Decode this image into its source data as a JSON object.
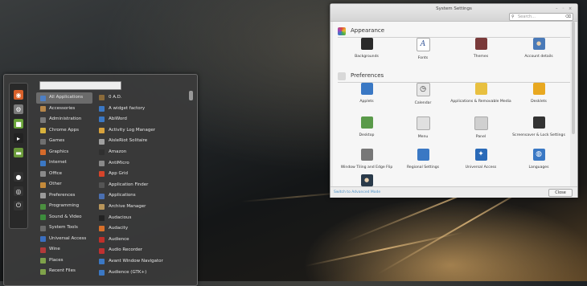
{
  "menu": {
    "categories": [
      {
        "label": "All Applications",
        "color": "#4d7fc4"
      },
      {
        "label": "Accessories",
        "color": "#b6864a"
      },
      {
        "label": "Administration",
        "color": "#7a7a7a"
      },
      {
        "label": "Chrome Apps",
        "color": "#d8b23c"
      },
      {
        "label": "Games",
        "color": "#6f6f6f"
      },
      {
        "label": "Graphics",
        "color": "#d66a2a"
      },
      {
        "label": "Internet",
        "color": "#3b78c4"
      },
      {
        "label": "Office",
        "color": "#8a8a8a"
      },
      {
        "label": "Other",
        "color": "#c48a3a"
      },
      {
        "label": "Preferences",
        "color": "#9a9a9a"
      },
      {
        "label": "Programming",
        "color": "#4b8f3f"
      },
      {
        "label": "Sound & Video",
        "color": "#3c8c3c"
      },
      {
        "label": "System Tools",
        "color": "#6b6b6b"
      },
      {
        "label": "Universal Access",
        "color": "#3b6fc0"
      },
      {
        "label": "Wine",
        "color": "#b33a3a"
      },
      {
        "label": "Places",
        "color": "#7fa24a"
      },
      {
        "label": "Recent Files",
        "color": "#7fa24a"
      }
    ],
    "apps": [
      {
        "label": "0 A.D.",
        "color": "#8a6a3a"
      },
      {
        "label": "A widget factory",
        "color": "#3b78c4"
      },
      {
        "label": "AbiWord",
        "color": "#3b78c4"
      },
      {
        "label": "Activity Log Manager",
        "color": "#d8a23c"
      },
      {
        "label": "AisleRiot Solitaire",
        "color": "#a0a0a0"
      },
      {
        "label": "Amazon",
        "color": "#303030"
      },
      {
        "label": "AntiMicro",
        "color": "#8a8a8a"
      },
      {
        "label": "App Grid",
        "color": "#d6442a"
      },
      {
        "label": "Application Finder",
        "color": "#555555"
      },
      {
        "label": "Applications",
        "color": "#4a6fb0"
      },
      {
        "label": "Archive Manager",
        "color": "#b8955a"
      },
      {
        "label": "Audacious",
        "color": "#222222"
      },
      {
        "label": "Audacity",
        "color": "#d8702a"
      },
      {
        "label": "Audience",
        "color": "#c0302a"
      },
      {
        "label": "Audio Recorder",
        "color": "#c03030"
      },
      {
        "label": "Avant Window Navigator",
        "color": "#3b78c4"
      },
      {
        "label": "Audience (GTK+)",
        "color": "#3b78c4"
      }
    ],
    "favorites": [
      {
        "icon": "firefox-icon",
        "glyph": "◉",
        "color": "#d8602a"
      },
      {
        "icon": "settings-icon",
        "glyph": "⚙",
        "color": "#7a7a7a"
      },
      {
        "icon": "software-icon",
        "glyph": "■",
        "color": "#6aa43a"
      },
      {
        "icon": "terminal-icon",
        "glyph": "▸",
        "color": "#222222"
      },
      {
        "icon": "files-icon",
        "glyph": "▬",
        "color": "#6a9a3a"
      },
      {
        "icon": "lock-icon",
        "glyph": "●",
        "color": "#333333"
      },
      {
        "icon": "logout-icon",
        "glyph": "◎",
        "color": "#333333"
      },
      {
        "icon": "shutdown-icon",
        "glyph": "⏻",
        "color": "#333333"
      }
    ]
  },
  "window": {
    "title": "System Settings",
    "search_placeholder": "Search...",
    "advanced_link": "Switch to Advanced Mode",
    "close_label": "Close",
    "sections": [
      {
        "title": "Appearance",
        "icon": "appearance-icon",
        "color": "#e05a2a",
        "items": [
          {
            "label": "Backgrounds",
            "icon": "backgrounds-icon",
            "color": "#2a2a2a"
          },
          {
            "label": "Fonts",
            "icon": "fonts-icon",
            "color": "#ffffff"
          },
          {
            "label": "Themes",
            "icon": "themes-icon",
            "color": "#7a3a3a"
          },
          {
            "label": "Account details",
            "icon": "account-icon",
            "color": "#4a7ab8"
          }
        ]
      },
      {
        "title": "Preferences",
        "icon": "preferences-icon",
        "color": "#d8d8d8",
        "items": [
          {
            "label": "Applets",
            "icon": "applets-icon",
            "color": "#3a78c4"
          },
          {
            "label": "Calendar",
            "icon": "calendar-icon",
            "color": "#e8e8e8"
          },
          {
            "label": "Applications & Removable Media",
            "icon": "media-icon",
            "color": "#e8c040"
          },
          {
            "label": "Desklets",
            "icon": "desklets-icon",
            "color": "#e8a820"
          },
          {
            "label": "Desktop",
            "icon": "desktop-icon",
            "color": "#5a9a4a"
          },
          {
            "label": "Menu",
            "icon": "menu-icon",
            "color": "#e0e0e0"
          },
          {
            "label": "Panel",
            "icon": "panel-icon",
            "color": "#d0d0d0"
          },
          {
            "label": "Screensaver & Lock Settings",
            "icon": "screensaver-icon",
            "color": "#333333"
          },
          {
            "label": "Window Tiling and Edge Flip",
            "icon": "tiling-icon",
            "color": "#777777"
          },
          {
            "label": "Regional Settings",
            "icon": "regional-icon",
            "color": "#3a78c4"
          },
          {
            "label": "Universal Access",
            "icon": "universal-access-icon",
            "color": "#2a6ab8"
          },
          {
            "label": "Languages",
            "icon": "languages-icon",
            "color": "#3a78c4"
          },
          {
            "label": "",
            "icon": "user-icon",
            "color": "#2a3a4a"
          }
        ]
      }
    ]
  }
}
